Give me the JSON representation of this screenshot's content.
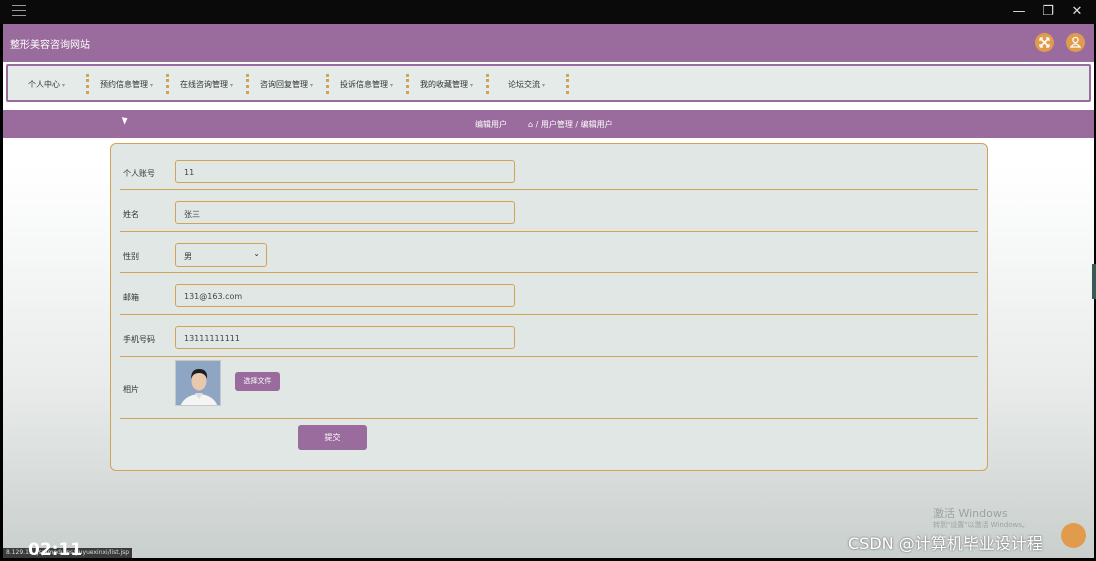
{
  "os_bar": {
    "minimize": "—",
    "restore": "❐",
    "close": "✕"
  },
  "header": {
    "site_title": "整形美容咨询网站"
  },
  "nav": {
    "items": [
      "个人中心",
      "预约信息管理",
      "在线咨询管理",
      "咨询回复管理",
      "投诉信息管理",
      "我的收藏管理",
      "论坛交流"
    ]
  },
  "breadcrumb": {
    "page_title": "编辑用户",
    "path": "⌂ / 用户管理 / 编辑用户"
  },
  "form": {
    "account_label": "个人账号",
    "account_value": "11",
    "name_label": "姓名",
    "name_value": "张三",
    "gender_label": "性别",
    "gender_value": "男",
    "email_label": "邮箱",
    "email_value": "131@163.com",
    "phone_label": "手机号码",
    "phone_value": "13111111111",
    "photo_label": "相片",
    "file_button": "选择文件",
    "submit_button": "提交"
  },
  "watermark": {
    "line1": "激活 Windows",
    "line2": "转到\"设置\"以激活 Windows。"
  },
  "overlay": {
    "status_url": "8.129.1…/jsp/modules/yuyuexinxi/list.jsp",
    "timer": "02:11",
    "csdn": "CSDN @计算机毕业设计程"
  },
  "colors": {
    "primary": "#9a6b9d",
    "accent": "#e09b4d",
    "border": "#d2a356",
    "panel": "#e1e7e5"
  }
}
